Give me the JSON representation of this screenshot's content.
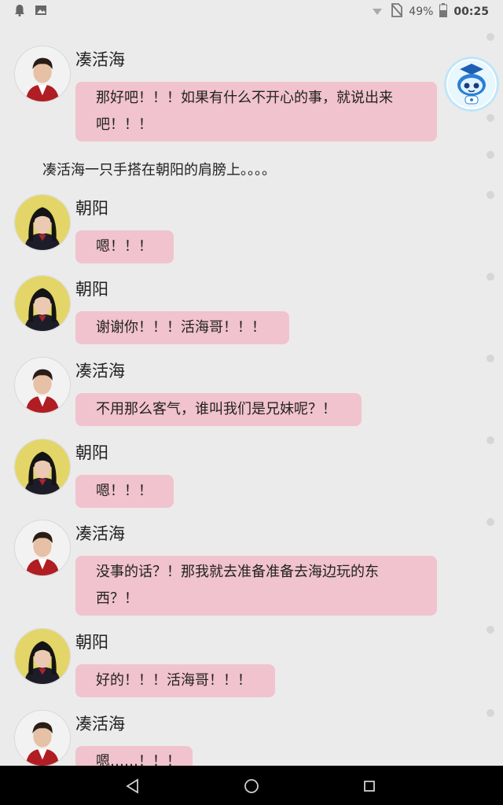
{
  "status_bar": {
    "left_icons": [
      "notification-bell-icon",
      "image-icon"
    ],
    "right_icons": [
      "wifi-icon",
      "no-sim-icon"
    ],
    "battery": "49%",
    "time": "00:25"
  },
  "chat": {
    "messages": [
      {
        "type": "message",
        "speaker": "凑活海",
        "text_lines": [
          "那好吧！！！如果有什么不开心的事，就说出来",
          "吧！！！"
        ]
      },
      {
        "type": "narration",
        "text": "凑活海一只手搭在朝阳的肩膀上。。。。"
      },
      {
        "type": "message",
        "speaker": "朝阳",
        "text_lines": [
          "嗯！！！"
        ]
      },
      {
        "type": "message",
        "speaker": "朝阳",
        "text_lines": [
          "谢谢你！！！活海哥！！！"
        ]
      },
      {
        "type": "message",
        "speaker": "凑活海",
        "text_lines": [
          "不用那么客气，谁叫我们是兄妹呢？！"
        ]
      },
      {
        "type": "message",
        "speaker": "朝阳",
        "text_lines": [
          "嗯！！！"
        ]
      },
      {
        "type": "message",
        "speaker": "凑活海",
        "text_lines": [
          "没事的话？！那我就去准备准备去海边玩的东",
          "西？！"
        ]
      },
      {
        "type": "message",
        "speaker": "朝阳",
        "text_lines": [
          "好的！！！活海哥！！！"
        ]
      },
      {
        "type": "message",
        "speaker": "凑活海",
        "text_lines": [
          "嗯……！！！"
        ]
      }
    ]
  },
  "floating_assistant": {
    "icon": "robot-assistant-icon"
  },
  "nav_bar": {
    "icons": [
      "back-icon",
      "home-icon",
      "recents-icon"
    ]
  },
  "colors": {
    "bubble": "#f1c3ce",
    "background": "#ebebeb",
    "navbar": "#000000"
  }
}
